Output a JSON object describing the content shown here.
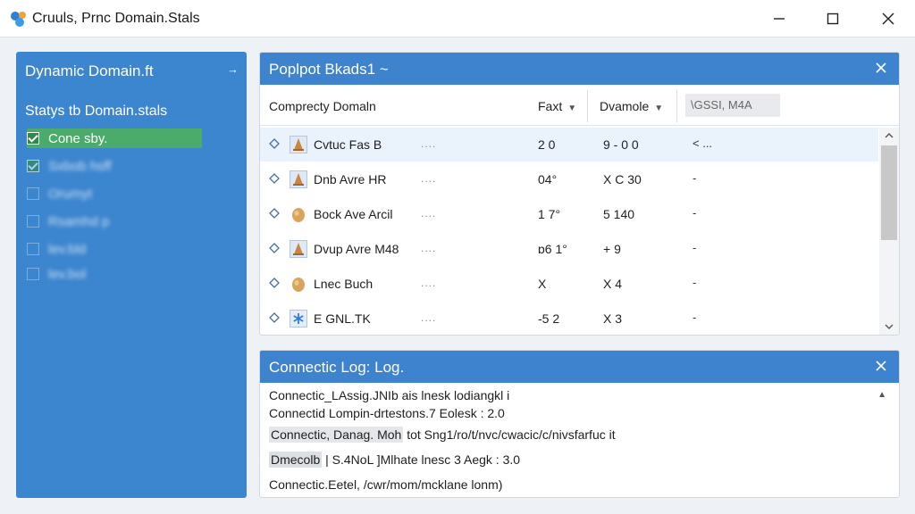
{
  "window": {
    "title": "Cruuls, Prnc Domain.Stals"
  },
  "sidebar": {
    "header": "Dynamic Domain.ft",
    "arrow": "→",
    "section_title": "Statys tb Domain.stals",
    "items": [
      {
        "label": "Cone sby.",
        "checked": true,
        "selected": true
      },
      {
        "label": "Sxbob hsff",
        "checked": true,
        "selected": false
      },
      {
        "label": "Orumyt",
        "checked": false,
        "selected": false
      },
      {
        "label": "Rsamhd p",
        "checked": false,
        "selected": false
      },
      {
        "label": "lev.bld",
        "checked": false,
        "selected": false
      },
      {
        "label": "lev.bol",
        "checked": false,
        "selected": false
      }
    ]
  },
  "domains_panel": {
    "title": "Poplpot Bkads1 ~",
    "columns": {
      "domain": "Comprecty Domaln",
      "fast": "Faxt",
      "domain2": "Dvamole",
      "search": "\\GSSI, M4A"
    },
    "sort_glyph": "▼",
    "rows": [
      {
        "name": "Cvtuc Fas B",
        "dots": "....",
        "c1": "2 0",
        "c2": "9 - 0 0",
        "c3": "< ...",
        "icon": "cone-icon"
      },
      {
        "name": "Dnb Avre HR",
        "dots": "....",
        "c1": "04°",
        "c2": "X   C 30",
        "c3": "-",
        "icon": "cone-icon"
      },
      {
        "name": "Bock Ave Arcil",
        "dots": "....",
        "c1": "1 7°",
        "c2": "5   140",
        "c3": "-",
        "icon": "egg-icon"
      },
      {
        "name": "Dvup Avre M48",
        "dots": "....",
        "c1": "ɒ6 1°",
        "c2": "+   9",
        "c3": "-",
        "icon": "cone-icon"
      },
      {
        "name": "Lnec Buch",
        "dots": "....",
        "c1": "X",
        "c2": "X   4",
        "c3": "-",
        "icon": "egg-icon"
      },
      {
        "name": "E GNL.TK",
        "dots": "....",
        "c1": "-5 2",
        "c2": "X   3",
        "c3": "-",
        "icon": "asterisk-icon"
      }
    ]
  },
  "log_panel": {
    "title": "Connectic Log: Log.",
    "lines": [
      {
        "prefix": "Connectic_LAssig.JNIb",
        "text": " ais lnesk lodiangkl i"
      },
      {
        "prefix": "Connectid Lompin-drtestons",
        "text": ".7 Eolesk : 2.0"
      },
      {
        "prefix": "Connectic, Danag. Moh",
        "text": " tot Sng1/ro/t/nvc/cwacic/c/nivsfarfuc it"
      },
      {
        "prefix": "Dmecolb",
        "text": " | S.4NoL ]Mlhate lnesc 3 Aegk : 3.0"
      },
      {
        "prefix": "Connectic.Eetel,",
        "text": " /cwr/mom/mcklane lonm)"
      }
    ]
  },
  "colors": {
    "accent": "#3d83cd",
    "sidebar": "#3c85cf",
    "selected_item": "#4bab6a"
  }
}
